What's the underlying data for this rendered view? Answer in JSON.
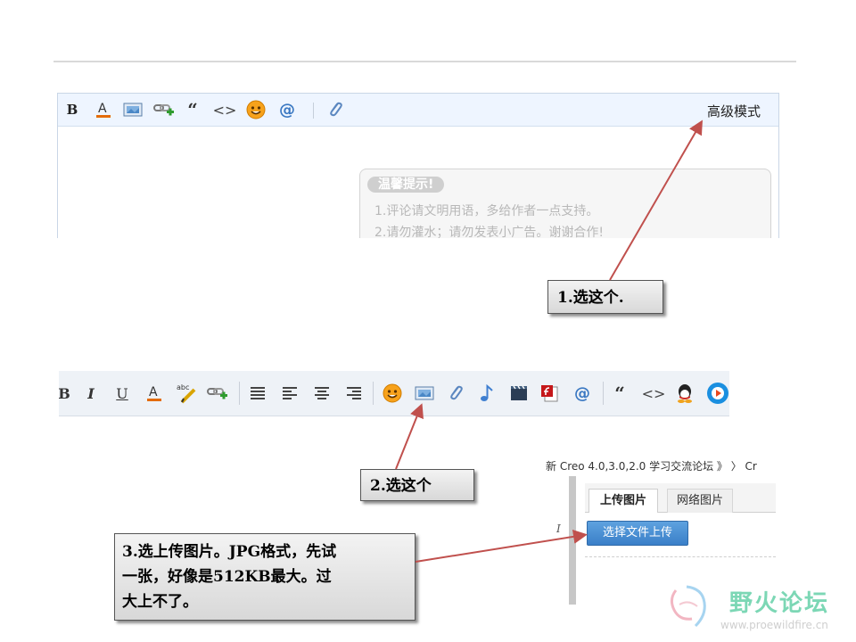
{
  "editor1": {
    "advanced_mode": "高级模式",
    "tips_title": "温馨提示!",
    "tips": [
      "1.评论请文明用语，多给作者一点支持。",
      "2.请勿灌水；请勿发表小广告。谢谢合作!"
    ]
  },
  "callouts": {
    "step1": "1.选这个.",
    "step2": "2.选这个",
    "step3": [
      "3.选上传图片。JPG格式，先试",
      "一张，好像是512KB最大。过",
      "大上不了。"
    ]
  },
  "upload_panel": {
    "breadcrumb": "新 Creo 4.0,3.0,2.0 学习交流论坛 》 〉 Cr",
    "tab_upload": "上传图片",
    "tab_web": "网络图片",
    "upload_button": "选择文件上传",
    "side_label": "I"
  },
  "watermark": {
    "name": "野火论坛",
    "url": "www.proewildfire.cn"
  },
  "colors": {
    "arrow": "#c0504d",
    "toolbar_bg": "#eef5ff",
    "upload_button": "#3f84cc",
    "logo": "#7cd7b5"
  },
  "icons": {
    "toolbar1": [
      "bold-icon",
      "font-color-icon",
      "image-icon",
      "link-icon",
      "quote-icon",
      "code-icon",
      "emoji-icon",
      "at-icon",
      "attachment-icon"
    ],
    "toolbar2": [
      "bold-icon",
      "italic-icon",
      "underline-icon",
      "font-color-icon",
      "spellcheck-icon",
      "link-icon",
      "align-justify-icon",
      "align-left-icon",
      "align-center-icon",
      "align-right-icon",
      "emoji-icon",
      "image-icon",
      "attachment-icon",
      "music-icon",
      "video-icon",
      "flash-icon",
      "at-icon",
      "quote-icon",
      "code-icon",
      "qq-icon",
      "play-icon"
    ]
  }
}
